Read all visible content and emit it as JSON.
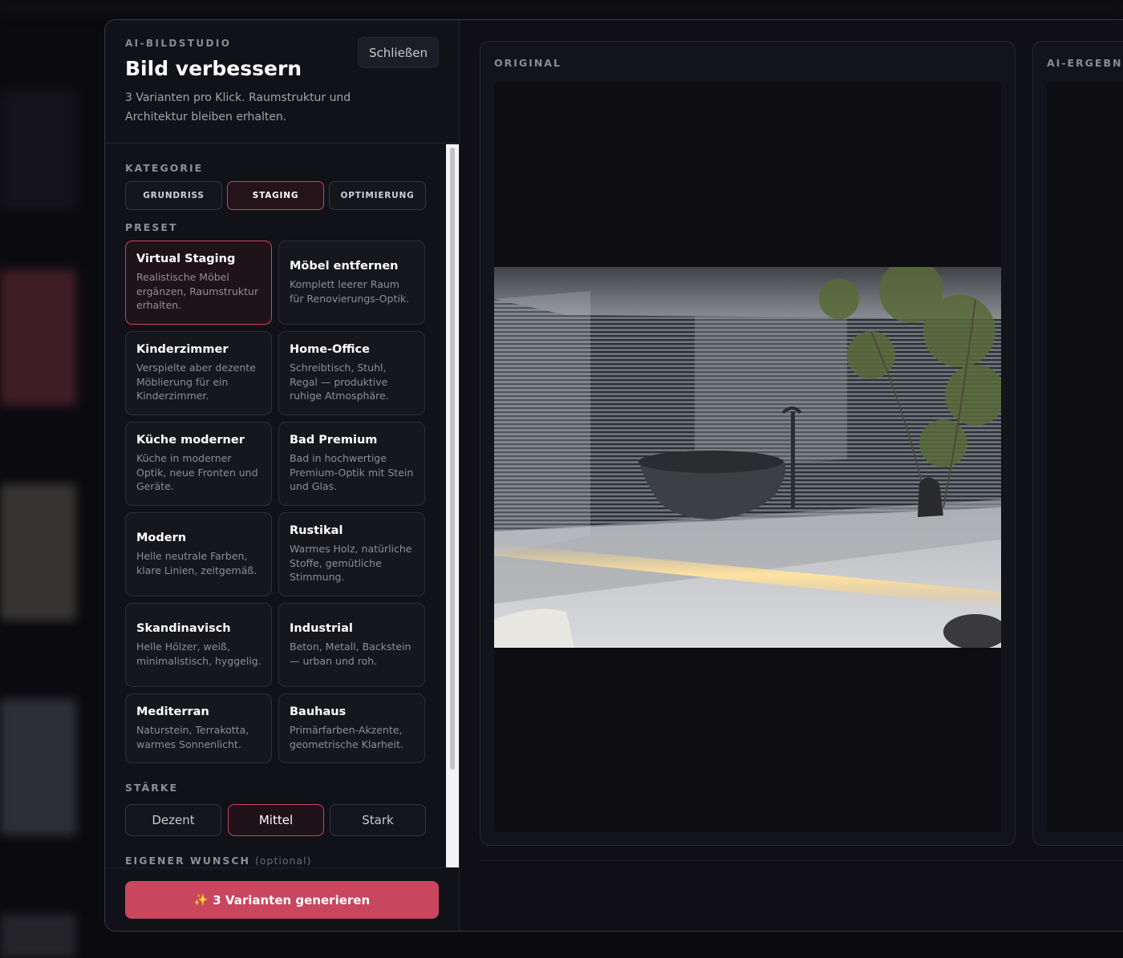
{
  "header": {
    "eyebrow": "AI-BILDSTUDIO",
    "title": "Bild verbessern",
    "subtitle": "3 Varianten pro Klick. Raumstruktur und Architektur bleiben erhalten.",
    "close_label": "Schließen"
  },
  "category": {
    "label": "KATEGORIE",
    "options": [
      "GRUNDRISS",
      "STAGING",
      "OPTIMIERUNG"
    ],
    "selected": "STAGING"
  },
  "preset": {
    "label": "PRESET",
    "selected": "Virtual Staging",
    "items": [
      {
        "title": "Virtual Staging",
        "desc": "Realistische Möbel ergänzen, Raumstruktur erhalten."
      },
      {
        "title": "Möbel entfernen",
        "desc": "Komplett leerer Raum für Renovierungs-Optik."
      },
      {
        "title": "Kinderzimmer",
        "desc": "Verspielte aber dezente Möblierung für ein Kinderzimmer."
      },
      {
        "title": "Home-Office",
        "desc": "Schreibtisch, Stuhl, Regal — produktive ruhige Atmosphäre."
      },
      {
        "title": "Küche moderner",
        "desc": "Küche in moderner Optik, neue Fronten und Geräte."
      },
      {
        "title": "Bad Premium",
        "desc": "Bad in hochwertige Premium-Optik mit Stein und Glas."
      },
      {
        "title": "Modern",
        "desc": "Helle neutrale Farben, klare Linien, zeitgemäß."
      },
      {
        "title": "Rustikal",
        "desc": "Warmes Holz, natürliche Stoffe, gemütliche Stimmung."
      },
      {
        "title": "Skandinavisch",
        "desc": "Helle Hölzer, weiß, minimalistisch, hyggelig."
      },
      {
        "title": "Industrial",
        "desc": "Beton, Metall, Backstein — urban und roh."
      },
      {
        "title": "Mediterran",
        "desc": "Naturstein, Terrakotta, warmes Sonnenlicht."
      },
      {
        "title": "Bauhaus",
        "desc": "Primärfarben-Akzente, geometrische Klarheit."
      }
    ]
  },
  "strength": {
    "label": "STÄRKE",
    "options": [
      "Dezent",
      "Mittel",
      "Stark"
    ],
    "selected": "Mittel"
  },
  "custom_wish": {
    "label": "EIGENER WUNSCH",
    "optional_note": "(optional)"
  },
  "generate": {
    "label": "3 Varianten generieren",
    "icon": "sparkles-icon"
  },
  "panels": {
    "original_label": "ORIGINAL",
    "result_label": "AI-ERGEBNIS"
  },
  "colors": {
    "accent": "#c9465f",
    "modal_bg": "#0f0f15",
    "sidebar_bg": "#111118"
  }
}
